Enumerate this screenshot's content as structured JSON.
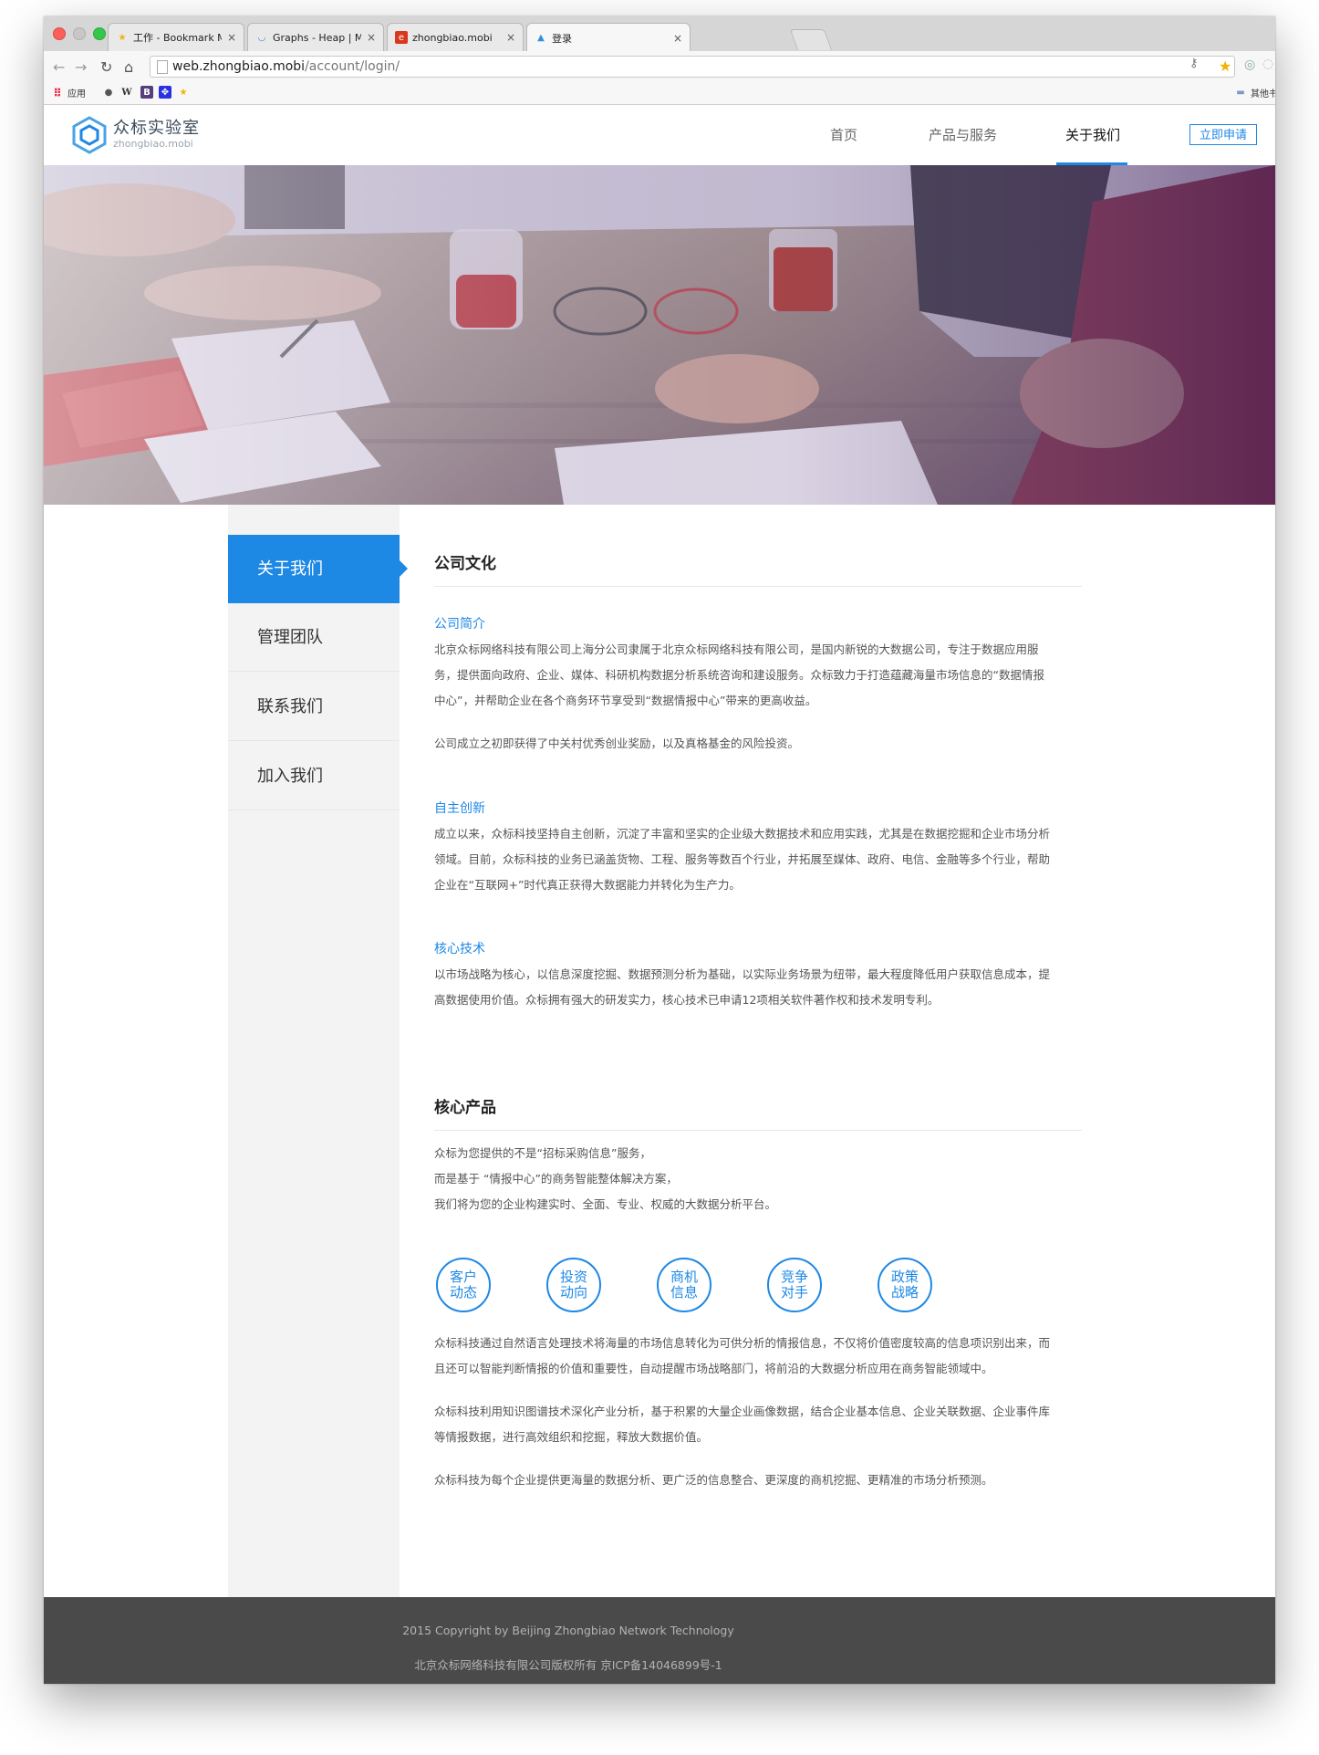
{
  "browser": {
    "tabs": [
      {
        "title": "工作 - Bookmark Manager",
        "icon": "star-folder-icon",
        "color": "#f1b400"
      },
      {
        "title": "Graphs - Heap | Mobile and",
        "icon": "heap-icon",
        "color": "#3b7ddd"
      },
      {
        "title": "zhongbiao.mobi",
        "icon": "zhongbiao-icon",
        "color": "#d9381e"
      },
      {
        "title": "登录",
        "icon": "mobi-icon",
        "color": "#2f8fe0"
      }
    ],
    "close_glyph": "×",
    "address_host": "web.zhongbiao.mobi",
    "address_path": "/account/login/",
    "bookmarks": [
      {
        "label": "应用",
        "icon": "apps-grid-icon"
      },
      {
        "label": "",
        "icon": "apple-icon"
      },
      {
        "label": "W",
        "icon": "wikipedia-icon"
      },
      {
        "label": "B",
        "icon": "bootstrap-icon"
      },
      {
        "label": "",
        "icon": "baidu-icon"
      },
      {
        "label": "",
        "icon": "star-icon"
      }
    ],
    "bookmarks_other": "其他书签"
  },
  "header": {
    "logo_name": "众标实验室",
    "logo_sub": "zhongbiao.mobi",
    "nav": [
      "首页",
      "产品与服务",
      "关于我们"
    ],
    "active_nav": "关于我们",
    "apply_label": "立即申请",
    "accent": "#1e88e5"
  },
  "sidebar": {
    "items": [
      "关于我们",
      "管理团队",
      "联系我们",
      "加入我们"
    ]
  },
  "culture": {
    "title": "公司文化",
    "intro_title": "公司简介",
    "intro_p1_lines": [
      "北京众标网络科技有限公司上海分公司隶属于北京众标网络科技有限公司，是国内新锐的大数据公司，专注于数据应用服",
      "务，提供面向政府、企业、媒体、科研机构数据分析系统咨询和建设服务。众标致力于打造蕴藏海量市场信息的“数据情报",
      "中心”，并帮助企业在各个商务环节享受到“数据情报中心”带来的更高收益。"
    ],
    "intro_p2": "公司成立之初即获得了中关村优秀创业奖励，以及真格基金的风险投资。",
    "innovation_title": "自主创新",
    "innovation_lines": [
      "成立以来，众标科技坚持自主创新，沉淀了丰富和坚实的企业级大数据技术和应用实践，尤其是在数据挖掘和企业市场分析",
      "领域。目前，众标科技的业务已涵盖货物、工程、服务等数百个行业，并拓展至媒体、政府、电信、金融等多个行业，帮助",
      "企业在“互联网+”时代真正获得大数据能力并转化为生产力。"
    ],
    "tech_title": "核心技术",
    "tech_lines": [
      "以市场战略为核心，以信息深度挖掘、数据预测分析为基础，以实际业务场景为纽带，最大程度降低用户获取信息成本，提",
      "高数据使用价值。众标拥有强大的研发实力，核心技术已申请12项相关软件著作权和技术发明专利。"
    ]
  },
  "products": {
    "title": "核心产品",
    "intro_lines": [
      "众标为您提供的不是“招标采购信息”服务，",
      "而是基于 “情报中心”的商务智能整体解决方案，",
      "我们将为您的企业构建实时、全面、专业、权威的大数据分析平台。"
    ],
    "circles": [
      [
        "客户",
        "动态"
      ],
      [
        "投资",
        "动向"
      ],
      [
        "商机",
        "信息"
      ],
      [
        "竞争",
        "对手"
      ],
      [
        "政策",
        "战略"
      ]
    ],
    "p1_lines": [
      "众标科技通过自然语言处理技术将海量的市场信息转化为可供分析的情报信息，不仅将价值密度较高的信息项识别出来，而",
      "且还可以智能判断情报的价值和重要性，自动提醒市场战略部门，将前沿的大数据分析应用在商务智能领域中。"
    ],
    "p2_lines": [
      "众标科技利用知识图谱技术深化产业分析，基于积累的大量企业画像数据，结合企业基本信息、企业关联数据、企业事件库",
      "等情报数据，进行高效组织和挖掘，释放大数据价值。"
    ],
    "p3": "众标科技为每个企业提供更海量的数据分析、更广泛的信息整合、更深度的商机挖掘、更精准的市场分析预测。"
  },
  "footer": {
    "copyright": "2015 Copyright by Beijing Zhongbiao Network Technology",
    "icp": "北京众标网络科技有限公司版权所有 京ICP备14046899号-1"
  }
}
